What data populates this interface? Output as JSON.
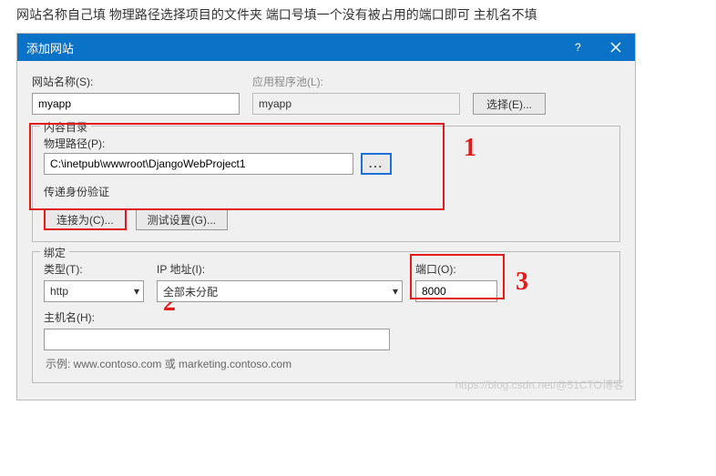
{
  "top_note": "网站名称自己填   物理路径选择项目的文件夹    端口号填一个没有被占用的端口即可   主机名不填",
  "dialog": {
    "title": "添加网站",
    "site_name_label": "网站名称(S):",
    "site_name_value": "myapp",
    "app_pool_label": "应用程序池(L):",
    "app_pool_value": "myapp",
    "select_button": "选择(E)...",
    "content_dir_legend": "内容目录",
    "physical_path_label": "物理路径(P):",
    "physical_path_value": "C:\\inetpub\\wwwroot\\DjangoWebProject1",
    "browse_button": "...",
    "passthrough_auth": "传递身份验证",
    "connect_as_button": "连接为(C)...",
    "test_settings_button": "测试设置(G)...",
    "binding_legend": "绑定",
    "type_label": "类型(T):",
    "type_value": "http",
    "ip_label": "IP 地址(I):",
    "ip_value": "全部未分配",
    "port_label": "端口(O):",
    "port_value": "8000",
    "hostname_label": "主机名(H):",
    "hostname_value": "",
    "example": "示例: www.contoso.com 或 marketing.contoso.com"
  },
  "annotations": {
    "n1": "1",
    "n2": "2",
    "n3": "3"
  },
  "watermark": "https://blog.csdn.net/@51CTO博客"
}
